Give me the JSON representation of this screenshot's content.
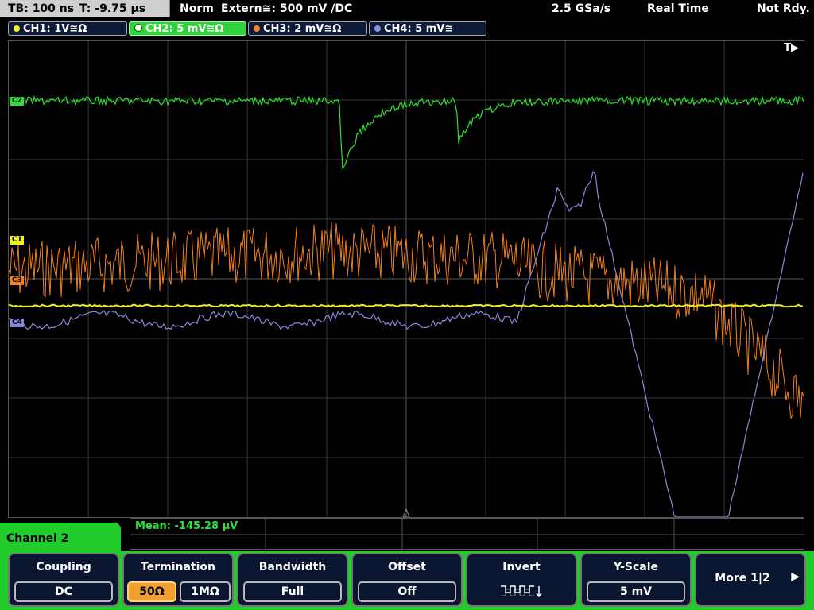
{
  "status": {
    "timebase": "TB: 100 ns",
    "trigger_time": "T: -9.75 µs",
    "mode": "Norm",
    "trigger_source": "Extern≅: 500 mV ∕DC",
    "sample_rate": "2.5 GSa/s",
    "acq_mode": "Real Time",
    "state": "Not Rdy."
  },
  "channels": [
    {
      "label": "CH1: 1V≅Ω",
      "color": "#f0f020"
    },
    {
      "label": "CH2: 5 mV≅Ω",
      "color": "#ffffff"
    },
    {
      "label": "CH3: 2 mV≅Ω",
      "color": "#f08030"
    },
    {
      "label": "CH4: 5 mV≅",
      "color": "#9090e0"
    }
  ],
  "markers": {
    "c2": "C2",
    "c1": "C1",
    "c3": "C3",
    "c4": "C4",
    "trigger": "T▶"
  },
  "measurement": {
    "text": "Mean: -145.28 µV"
  },
  "menu": {
    "title": "Channel 2",
    "coupling": {
      "title": "Coupling",
      "value": "DC"
    },
    "termination": {
      "title": "Termination",
      "opt1": "50Ω",
      "opt2": "1MΩ"
    },
    "bandwidth": {
      "title": "Bandwidth",
      "value": "Full"
    },
    "offset": {
      "title": "Offset",
      "value": "Off"
    },
    "invert": {
      "title": "Invert"
    },
    "yscale": {
      "title": "Y-Scale",
      "value": "5 mV"
    },
    "more": {
      "label": "More 1|2"
    }
  },
  "colors": {
    "ch1": "#f0f020",
    "ch2": "#30e030",
    "ch3": "#f08020",
    "ch4": "#8888dd",
    "accent": "#22cc2a"
  }
}
